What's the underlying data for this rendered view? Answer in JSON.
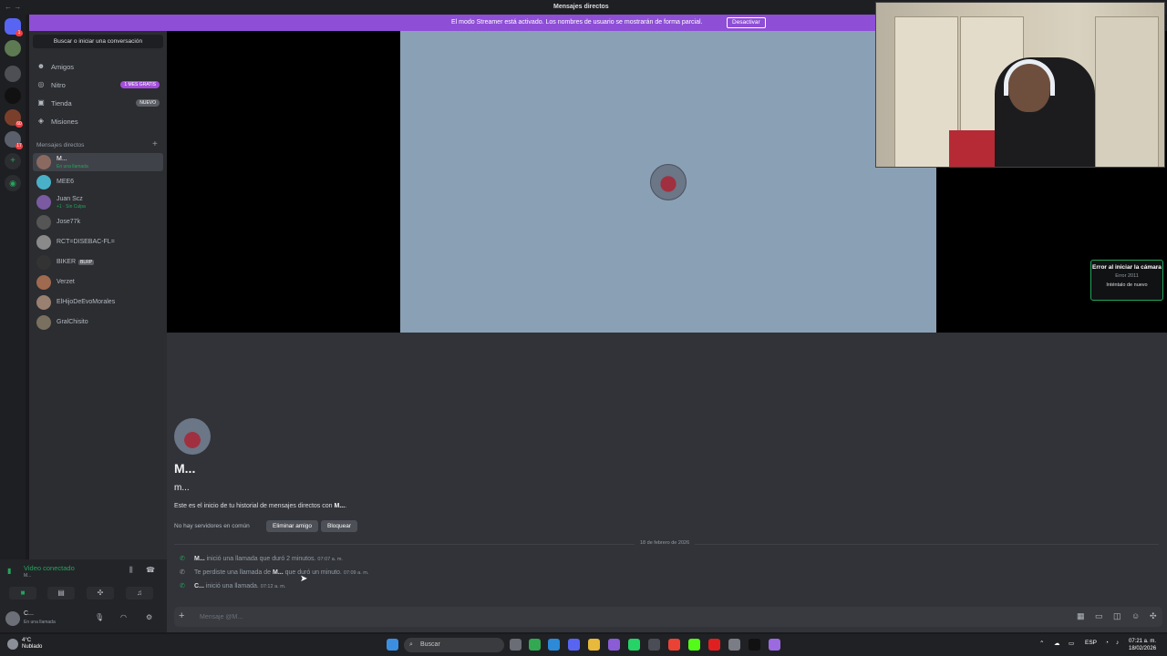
{
  "window": {
    "title": "Mensajes directos",
    "nav": "← →"
  },
  "banner": {
    "text": "El modo Streamer está activado. Los nombres de usuario se mostrarán de forma parcial.",
    "button": "Desactivar"
  },
  "servers": {
    "badges": [
      "1",
      "60",
      "17"
    ]
  },
  "sidebar": {
    "search": "Buscar o iniciar una conversación",
    "nav": [
      {
        "label": "Amigos",
        "icon": "friends-icon"
      },
      {
        "label": "Nitro",
        "icon": "nitro-icon",
        "pill": "1 MES GRATIS",
        "pill_color": "#a34ddb"
      },
      {
        "label": "Tienda",
        "icon": "shop-icon",
        "pill": "NUEVO",
        "pill_color": "#5c5e66"
      },
      {
        "label": "Misiones",
        "icon": "quests-icon"
      }
    ],
    "dm_header": "Mensajes directos",
    "dm_add": "+",
    "dms": [
      {
        "name": "M...",
        "sub": "En una llamada"
      },
      {
        "name": "MEE6"
      },
      {
        "name": "Juan Scz",
        "sub": "+1 · Sin Culpa"
      },
      {
        "name": "Jose77k"
      },
      {
        "name": "RCT=DISEBAC-FL="
      },
      {
        "name": "BIKER",
        "tag": "BLRP"
      },
      {
        "name": "Verzet"
      },
      {
        "name": "ElHijoDeEvoMorales"
      },
      {
        "name": "GralChisito"
      }
    ]
  },
  "voice": {
    "status": "Video conectado",
    "server": "M..."
  },
  "user": {
    "name": "C...",
    "status": "En una llamada"
  },
  "camera_error": {
    "title": "Error al iniciar la cámara",
    "code": "Error 2011",
    "retry": "Inténtalo de nuevo"
  },
  "chat": {
    "title": "M...",
    "username": "m...",
    "intro_prefix": "Este es el inicio de tu historial de mensajes directos con ",
    "intro_name": "M...",
    "intro_suffix": ".",
    "no_servers": "No hay servidores en común",
    "remove_friend": "Eliminar amigo",
    "block": "Bloquear",
    "date": "18 de febrero de 2026",
    "calls": [
      {
        "who": "M...",
        "text": " inició una llamada que duró 2 minutos.",
        "time": "07:07 a. m.",
        "missed": false
      },
      {
        "who": "M...",
        "prefix": "Te perdiste una llamada de ",
        "text": " que duró un minuto.",
        "time": "07:09 a. m.",
        "missed": true
      },
      {
        "who": "C...",
        "text": " inició una llamada.",
        "time": "07:12 a. m.",
        "missed": false
      }
    ],
    "input_placeholder": "Mensaje @M..."
  },
  "taskbar": {
    "weather_temp": "4°C",
    "weather_desc": "Nublado",
    "search": "Buscar",
    "lang": "ESP",
    "time": "07:21 a. m.",
    "date": "18/02/2026"
  }
}
